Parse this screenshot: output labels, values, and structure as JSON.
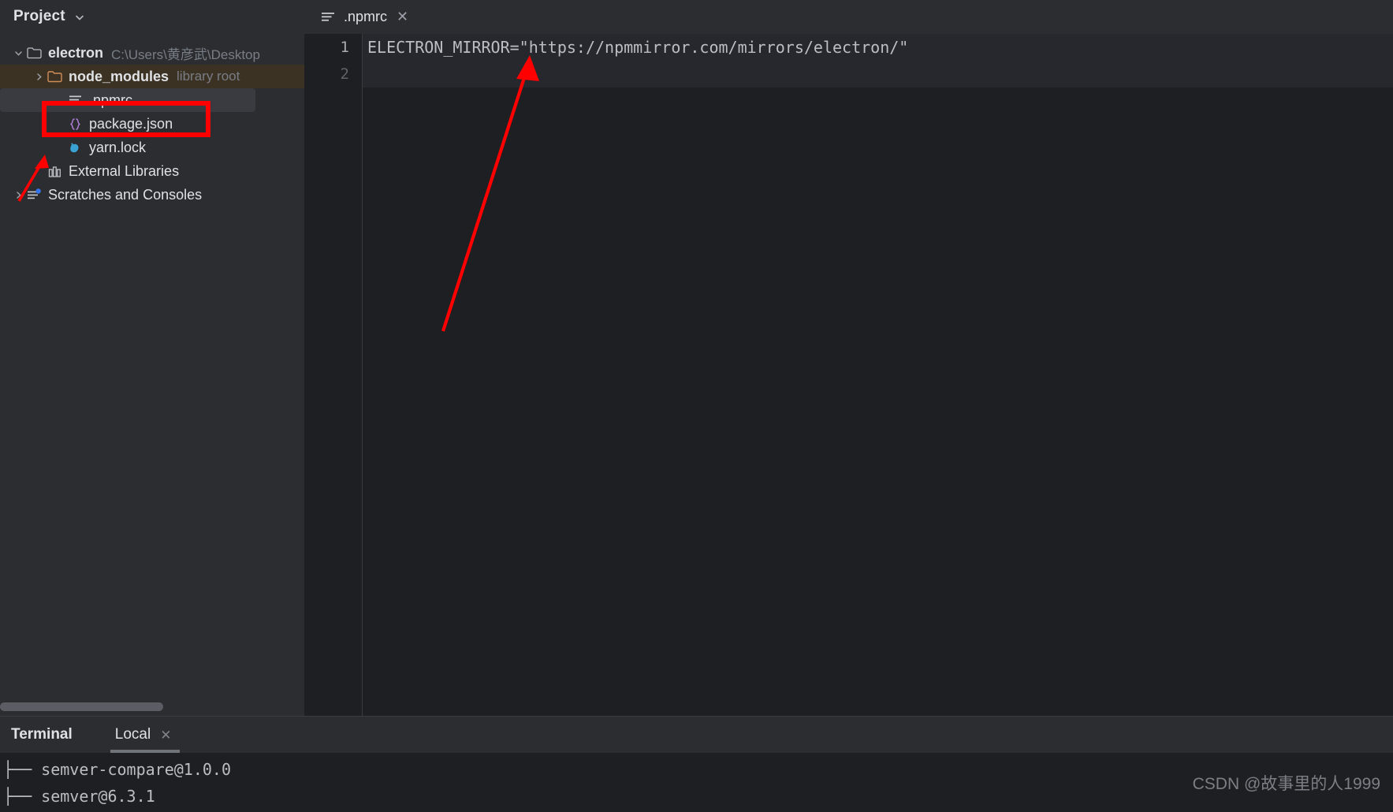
{
  "sidebar": {
    "title": "Project",
    "chevron_icon": "chevron-down-icon",
    "tree": [
      {
        "label": "electron",
        "sub": "C:\\Users\\黄彦武\\Desktop",
        "icon": "folder-icon",
        "arrow": "chevron-down-icon",
        "level": 0,
        "bold": true,
        "state": "expanded"
      },
      {
        "label": "node_modules",
        "sub": "library root",
        "icon": "folder-orange-icon",
        "arrow": "chevron-right-icon",
        "level": 1,
        "bold": true,
        "state": "collapsed"
      },
      {
        "label": ".npmrc",
        "sub": "",
        "icon": "lines-file-icon",
        "arrow": "",
        "level": 2,
        "bold": false,
        "state": "selected"
      },
      {
        "label": "package.json",
        "sub": "",
        "icon": "json-braces-icon",
        "arrow": "",
        "level": 2,
        "bold": false,
        "state": "normal"
      },
      {
        "label": "yarn.lock",
        "sub": "",
        "icon": "yarn-cat-icon",
        "arrow": "",
        "level": 2,
        "bold": false,
        "state": "normal"
      },
      {
        "label": "External Libraries",
        "sub": "",
        "icon": "library-books-icon",
        "arrow": "",
        "level": 1,
        "bold": false,
        "state": "normal"
      },
      {
        "label": "Scratches and Consoles",
        "sub": "",
        "icon": "scratches-icon",
        "arrow": "chevron-right-icon",
        "level": 0,
        "bold": false,
        "state": "collapsed"
      }
    ]
  },
  "editor": {
    "tab": {
      "name": ".npmrc",
      "icon": "lines-file-icon",
      "close_icon": "close-icon",
      "active": true,
      "underline_color": "#3574f0"
    },
    "line_numbers": [
      "1",
      "2"
    ],
    "lines": [
      "ELECTRON_MIRROR=\"https://npmmirror.com/mirrors/electron/\"",
      ""
    ]
  },
  "terminal": {
    "title": "Terminal",
    "tab": {
      "label": "Local",
      "close_icon": "close-icon"
    },
    "output": [
      "├── semver-compare@1.0.0",
      "├── semver@6.3.1"
    ]
  },
  "annotations": {
    "highlight_box_color": "#ff0000",
    "arrow_color": "#ff0000",
    "arrow_count": 2
  },
  "watermark": {
    "text": "CSDN @故事里的人1999"
  }
}
